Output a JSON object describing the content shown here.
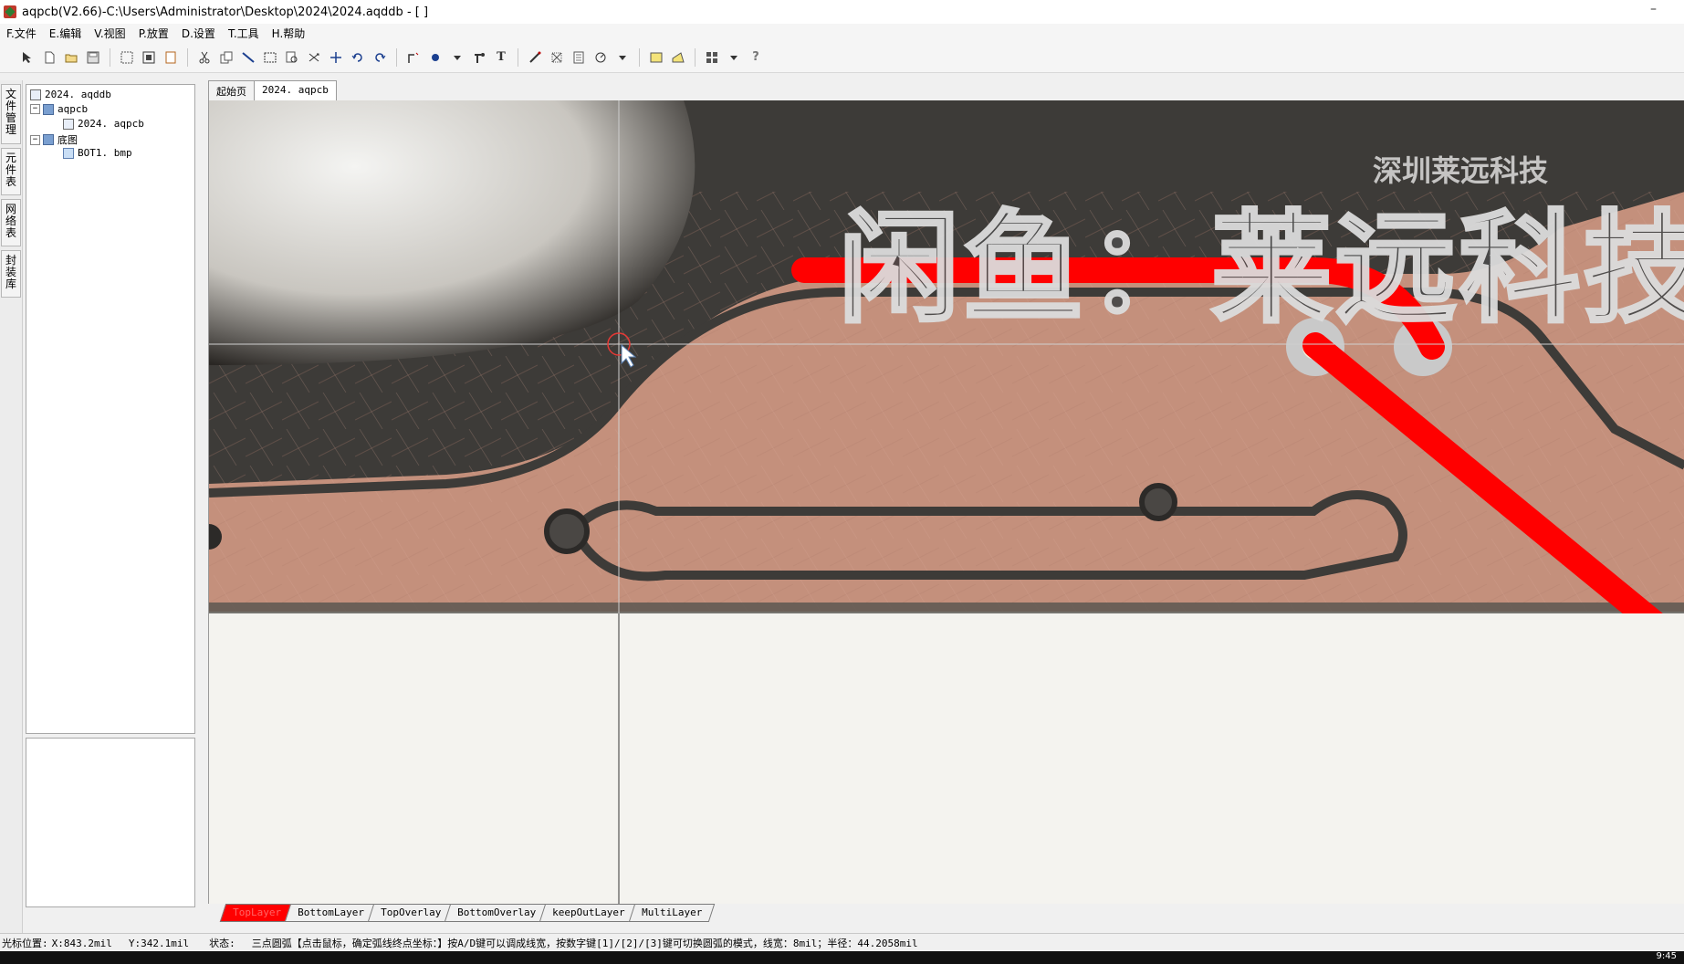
{
  "window": {
    "title": "aqpcb(V2.66)-C:\\Users\\Administrator\\Desktop\\2024\\2024.aqddb - [ ]",
    "minimize_glyph": "–"
  },
  "menu": {
    "items": [
      "F.文件",
      "E.编辑",
      "V.视图",
      "P.放置",
      "D.设置",
      "T.工具",
      "H.帮助"
    ]
  },
  "toolbar": {
    "icons": [
      "select-icon",
      "new-icon",
      "open-icon",
      "save-icon",
      "zoom-fit-icon",
      "zoom-area-icon",
      "zoom-window-icon",
      "print-preview-icon",
      "cut-icon",
      "copy-icon",
      "line-icon",
      "rect-select-icon",
      "find-icon",
      "move-icon",
      "cross-icon",
      "undo-icon",
      "redo-icon",
      "wire-icon",
      "via-icon",
      "dropdown-icon",
      "pad-icon",
      "text-icon",
      "ruler-icon",
      "grid-icon",
      "layer-icon",
      "arc-icon",
      "dropdown-icon",
      "fill-icon",
      "polygon-icon",
      "array-icon",
      "dropdown-icon",
      "help-icon"
    ],
    "help_glyph": "?",
    "text_glyph": "T"
  },
  "side_tabs": [
    "文件管理",
    "元件表",
    "网络表",
    "封装库"
  ],
  "tree": {
    "root": "2024. aqddb",
    "folder1": "aqpcb",
    "file1": "2024. aqpcb",
    "folder2": "底图",
    "file2": "BOT1. bmp"
  },
  "doc_tabs": [
    "起始页",
    "2024. aqpcb"
  ],
  "watermark": {
    "big": "闲鱼：莱远科技",
    "small": "深圳莱远科技"
  },
  "colors": {
    "copper": "#c4907c",
    "substrate": "#3d3b38",
    "trace_red": "#ff0000",
    "active_layer": "#ff0000"
  },
  "layers": [
    "TopLayer",
    "BottomLayer",
    "TopOverlay",
    "BottomOverlay",
    "keepOutLayer",
    "MultiLayer"
  ],
  "status": {
    "cursor_label": "光标位置:",
    "x": "X:843.2mil",
    "y": "Y:342.1mil",
    "state_label": "状态:",
    "message": "三点圆弧【点击鼠标，确定弧线终点坐标：】按A/D键可以调成线宽，按数字键[1]/[2]/[3]键可切换圆弧的模式，线宽：8mil；半径：44.2058mil"
  },
  "taskbar": {
    "clock": "9:45"
  }
}
